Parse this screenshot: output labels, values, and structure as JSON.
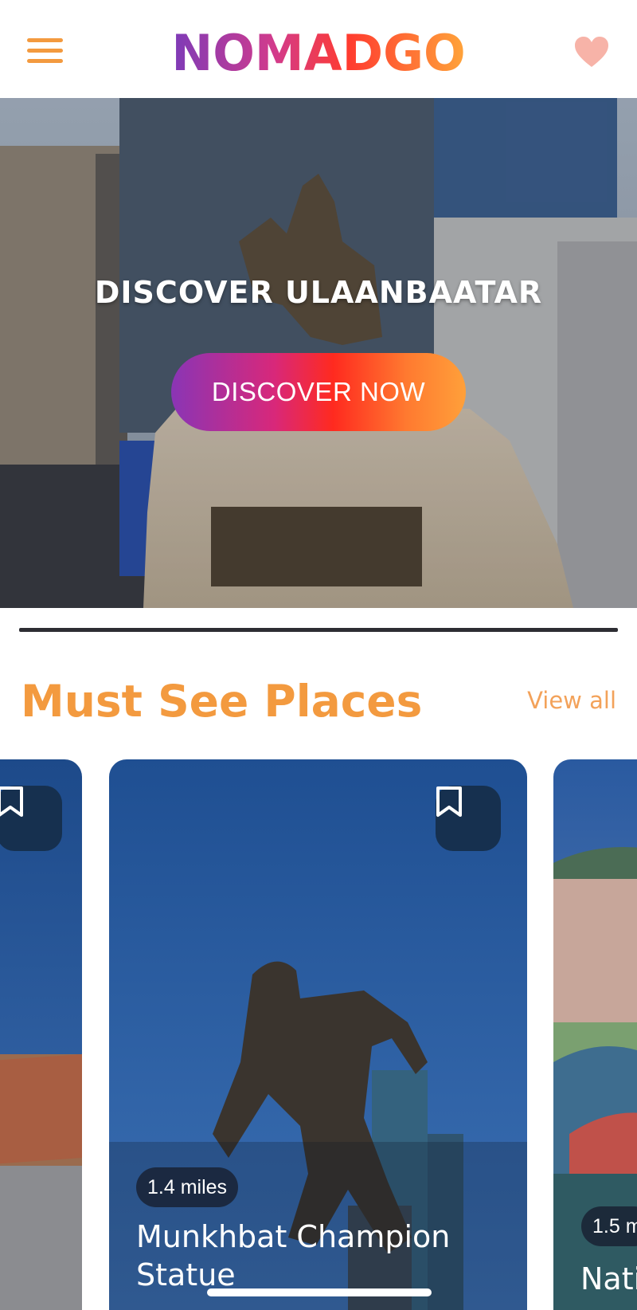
{
  "header": {
    "logo_text": "NOMADGO",
    "menu_icon": "hamburger-menu-icon",
    "favorite_icon": "heart-icon"
  },
  "hero": {
    "title": "DISCOVER ULAANBAATAR",
    "button_label": "DISCOVER NOW"
  },
  "section": {
    "title": "Must See Places",
    "view_all_label": "View all"
  },
  "cards": [
    {
      "title": "",
      "distance": ""
    },
    {
      "title": "Munkhbat Champion Statue",
      "distance": "1.4 miles"
    },
    {
      "title": "Nati",
      "distance": "1.5 m"
    }
  ],
  "colors": {
    "accent": "#f39a3f",
    "bookmark_bg": "#16304f",
    "gradient": [
      "#8a35b5",
      "#ff2a1f",
      "#ffa03a"
    ]
  }
}
